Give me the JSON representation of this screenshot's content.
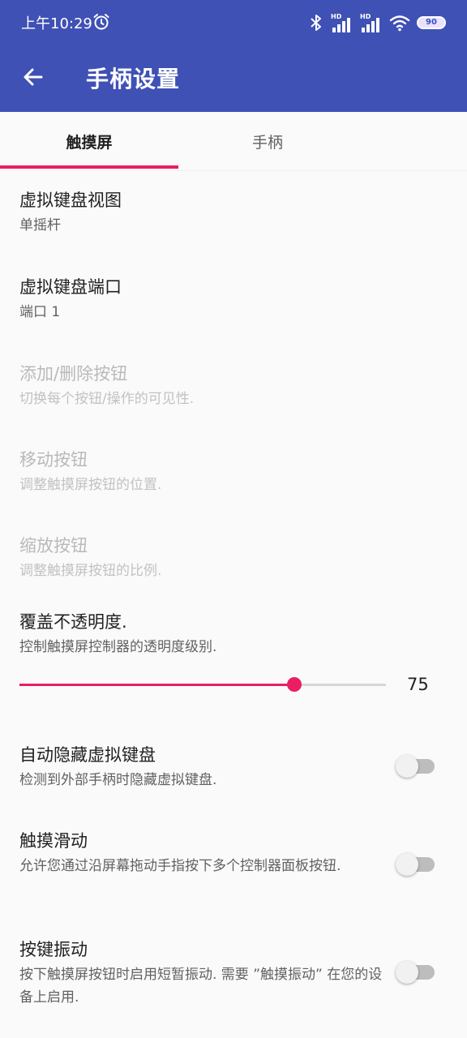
{
  "status_bar": {
    "time": "上午10:29",
    "battery": "90",
    "icons": [
      "alarm-icon",
      "bluetooth-icon",
      "signal-hd-icon",
      "signal-hd-icon",
      "wifi-icon",
      "battery-icon"
    ]
  },
  "toolbar": {
    "title": "手柄设置",
    "back_icon": "arrow-back-icon"
  },
  "tabs": [
    {
      "label": "触摸屏",
      "selected": true
    },
    {
      "label": "手柄",
      "selected": false
    }
  ],
  "preferences": [
    {
      "title": "虚拟键盘视图",
      "summary": "单摇杆",
      "enabled": true
    },
    {
      "title": "虚拟键盘端口",
      "summary": "端口 1",
      "enabled": true
    },
    {
      "title": "添加/删除按钮",
      "summary": "切换每个按钮/操作的可见性.",
      "enabled": false
    },
    {
      "title": "移动按钮",
      "summary": "调整触摸屏按钮的位置.",
      "enabled": false
    },
    {
      "title": "缩放按钮",
      "summary": "调整触摸屏按钮的比例.",
      "enabled": false
    },
    {
      "title": "覆盖不透明度.",
      "summary": "控制触摸屏控制器的透明度级别.",
      "enabled": true,
      "slider": {
        "value": "75",
        "min": 0,
        "max": 100
      }
    },
    {
      "title": "自动隐藏虚拟键盘",
      "summary": "检测到外部手柄时隐藏虚拟键盘.",
      "enabled": true,
      "switch_on": false
    },
    {
      "title": "触摸滑动",
      "summary": "允许您通过沿屏幕拖动手指按下多个控制器面板按钮.",
      "enabled": true,
      "switch_on": false
    },
    {
      "title": "按键振动",
      "summary": "按下触摸屏按钮时启用短暂振动. 需要 ”触摸振动” 在您的设备上启用.",
      "enabled": true,
      "switch_on": false
    }
  ],
  "colors": {
    "app_bar": "#3f51b5",
    "accent": "#e91e63",
    "background": "#fafafa",
    "text_primary": "#212121",
    "text_secondary": "#616161",
    "text_disabled": "#b9b9b9"
  }
}
